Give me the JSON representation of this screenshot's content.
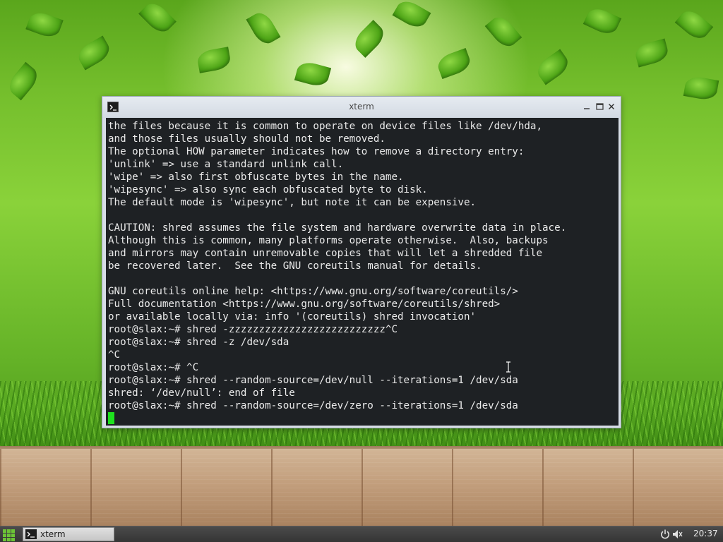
{
  "window": {
    "title": "xterm"
  },
  "terminal": {
    "lines": [
      "the files because it is common to operate on device files like /dev/hda,",
      "and those files usually should not be removed.",
      "The optional HOW parameter indicates how to remove a directory entry:",
      "'unlink' => use a standard unlink call.",
      "'wipe' => also first obfuscate bytes in the name.",
      "'wipesync' => also sync each obfuscated byte to disk.",
      "The default mode is 'wipesync', but note it can be expensive.",
      "",
      "CAUTION: shred assumes the file system and hardware overwrite data in place.",
      "Although this is common, many platforms operate otherwise.  Also, backups",
      "and mirrors may contain unremovable copies that will let a shredded file",
      "be recovered later.  See the GNU coreutils manual for details.",
      "",
      "GNU coreutils online help: <https://www.gnu.org/software/coreutils/>",
      "Full documentation <https://www.gnu.org/software/coreutils/shred>",
      "or available locally via: info '(coreutils) shred invocation'",
      "root@slax:~# shred -zzzzzzzzzzzzzzzzzzzzzzzzzz^C",
      "root@slax:~# shred -z /dev/sda",
      "^C",
      "root@slax:~# ^C",
      "root@slax:~# shred --random-source=/dev/null --iterations=1 /dev/sda",
      "shred: ‘/dev/null’: end of file",
      "root@slax:~# shred --random-source=/dev/zero --iterations=1 /dev/sda"
    ],
    "background_color": "#1e2124",
    "text_color": "#eaeaea",
    "cursor_color": "#1ee21e"
  },
  "taskbar": {
    "task_label": "xterm",
    "clock": "20:37",
    "accent_color": "#6cc436"
  },
  "icons": {
    "app": "terminal-icon",
    "minimize": "minimize-icon",
    "maximize": "maximize-icon",
    "close": "close-icon",
    "start": "start-menu-grid-icon",
    "power": "power-icon",
    "volume": "volume-muted-icon"
  }
}
